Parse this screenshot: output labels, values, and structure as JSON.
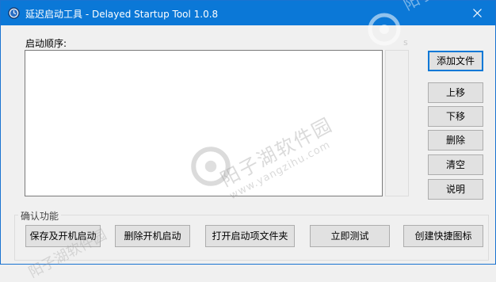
{
  "window": {
    "title": "延迟启动工具 - Delayed Startup Tool 1.0.8"
  },
  "labels": {
    "startup_order": "启动顺序:"
  },
  "side_buttons": {
    "add_file": "添加文件",
    "move_up": "上移",
    "move_down": "下移",
    "delete": "删除",
    "clear": "清空",
    "help": "说明"
  },
  "group": {
    "title": "确认功能",
    "buttons": {
      "save_startup": "保存及开机启动",
      "remove_startup": "删除开机启动",
      "open_folder": "打开启动项文件夹",
      "test_now": "立即测试",
      "create_shortcut": "创建快捷图标"
    }
  },
  "watermark": {
    "cn": "阳子湖软件园",
    "url": "www.yangzihu.com"
  },
  "colors": {
    "titlebar": "#0b78d7",
    "window_bg": "#f0f0f0",
    "default_button_border": "#0078d7"
  },
  "icons": {
    "app": "clock-icon",
    "close": "close-icon",
    "watermark_logo": "swirl-logo-icon"
  }
}
